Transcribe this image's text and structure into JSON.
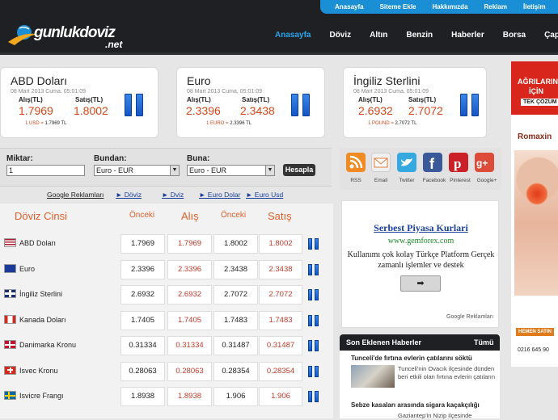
{
  "topnav": [
    "Anasayfa",
    "Siteme Ekle",
    "Hakkımızda",
    "Reklam",
    "İletişim"
  ],
  "logo": {
    "text": "gunlukdoviz",
    "suffix": ".net"
  },
  "mainnav": [
    {
      "label": "Anasayfa",
      "active": true
    },
    {
      "label": "Döviz"
    },
    {
      "label": "Altın"
    },
    {
      "label": "Benzin"
    },
    {
      "label": "Haberler"
    },
    {
      "label": "Borsa"
    },
    {
      "label": "Çapraz K"
    }
  ],
  "cards": [
    {
      "name": "ABD Doları",
      "date": "08 Mart 2013 Cuma, 05:01:09",
      "buy_label": "Alış(TL)",
      "sell_label": "Satış(TL)",
      "buy": "1.7969",
      "sell": "1.8002",
      "note_unit": "1 USD =",
      "note_value": "1.7969 TL"
    },
    {
      "name": "Euro",
      "date": "08 Mart 2013 Cuma, 05:01:09",
      "buy_label": "Alış(TL)",
      "sell_label": "Satış(TL)",
      "buy": "2.3396",
      "sell": "2.3438",
      "note_unit": "1 EURO =",
      "note_value": "2.3396 TL"
    },
    {
      "name": "İngiliz Sterlini",
      "date": "08 Mart 2013 Cuma, 05:01:09",
      "buy_label": "Alış(TL)",
      "sell_label": "Satış(TL)",
      "buy": "2.6932",
      "sell": "2.7072",
      "note_unit": "1 POUND =",
      "note_value": "2.7072 TL"
    }
  ],
  "calculator": {
    "amount_label": "Miktar:",
    "amount_value": "1",
    "from_label": "Bundan:",
    "from_value": "Euro - EUR",
    "to_label": "Buna:",
    "to_value": "Euro - EUR",
    "button": "Hesapla"
  },
  "links": {
    "google": "Google Reklamları",
    "items": [
      "► Döviz",
      "► Dviz",
      "► Euro Dolar",
      "► Euro Usd"
    ]
  },
  "table": {
    "headers": {
      "name": "Döviz Cinsi",
      "prev1": "Önceki",
      "buy": "Alış",
      "prev2": "Önceki",
      "sell": "Satış"
    },
    "rows": [
      {
        "name": "ABD Doları",
        "flag": "us",
        "prev_buy": "1.7969",
        "buy": "1.7969",
        "prev_sell": "1.8002",
        "sell": "1.8002"
      },
      {
        "name": "Euro",
        "flag": "eu",
        "prev_buy": "2.3396",
        "buy": "2.3396",
        "prev_sell": "2.3438",
        "sell": "2.3438"
      },
      {
        "name": "İngiliz Sterlini",
        "flag": "gb",
        "prev_buy": "2.6932",
        "buy": "2.6932",
        "prev_sell": "2.7072",
        "sell": "2.7072"
      },
      {
        "name": "Kanada Doları",
        "flag": "ca",
        "prev_buy": "1.7405",
        "buy": "1.7405",
        "prev_sell": "1.7483",
        "sell": "1.7483"
      },
      {
        "name": "Danimarka Kronu",
        "flag": "dk",
        "prev_buy": "0.31334",
        "buy": "0.31334",
        "prev_sell": "0.31487",
        "sell": "0.31487"
      },
      {
        "name": "Isvec Kronu",
        "flag": "ch",
        "prev_buy": "0.28063",
        "buy": "0.28063",
        "prev_sell": "0.28354",
        "sell": "0.28354"
      },
      {
        "name": "Isvicre Frangı",
        "flag": "se",
        "prev_buy": "1.8938",
        "buy": "1.8938",
        "prev_sell": "1.906",
        "sell": "1.906"
      }
    ]
  },
  "social": [
    {
      "label": "RSS",
      "icon": "rss-icon",
      "color": "#f08a24"
    },
    {
      "label": "Email",
      "icon": "email-icon",
      "color": "#e8e8e8"
    },
    {
      "label": "Twitter",
      "icon": "twitter-icon",
      "color": "#35a8e0"
    },
    {
      "label": "Facebook",
      "icon": "facebook-icon",
      "color": "#3b5998"
    },
    {
      "label": "Pinterest",
      "icon": "pinterest-icon",
      "color": "#cb2027"
    },
    {
      "label": "Google+",
      "icon": "google-plus-icon",
      "color": "#dd4b39"
    }
  ],
  "ad": {
    "title": "Serbest Piyasa Kurlari",
    "url": "www.gemforex.com",
    "desc": "Kullanımı çok kolay Türkçe Platform Gerçek zamanlı işlemler ve destek",
    "button": "➡",
    "google": "Google Reklamları"
  },
  "news": {
    "title": "Son Eklenen Haberler",
    "all": "Tümü",
    "items": [
      {
        "headline": "Tunceli'de fırtına evlerin çatılarını söktü",
        "text": "Tunceli'nin Ovacık ilçesinde dünden beri etkili olan fırtına evlerin çatıların"
      },
      {
        "headline": "Sebze kasaları arasında sigara kaçakçılığı",
        "text": "Gaziantep'in Nizip ilçesinde"
      }
    ]
  },
  "sidead": {
    "headline1": "AĞRILARINIZ",
    "headline2": "İÇİN",
    "headline3": "TEK ÇÖZÜM",
    "brand": "Romaxin",
    "button": "HEMEN SATIN",
    "phone": "0216 645 90"
  },
  "colors": {
    "accent": "#1b8fd6",
    "value_red": "#d84618",
    "header_bg": "#1f2024"
  }
}
